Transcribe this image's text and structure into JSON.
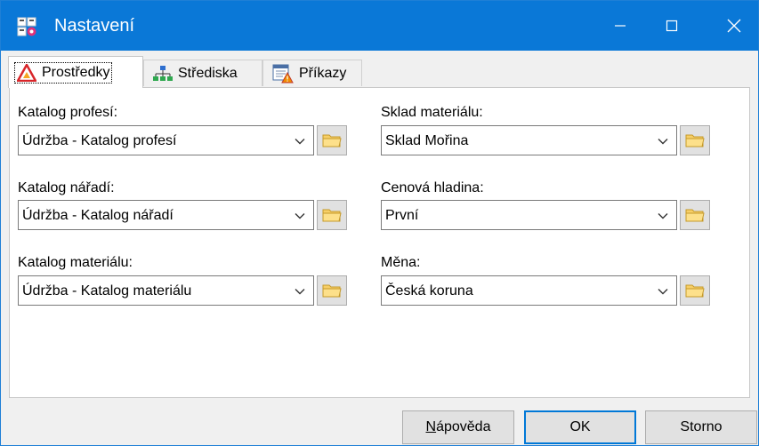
{
  "window": {
    "title": "Nastavení",
    "accent": "#0a78d7"
  },
  "tabs": [
    {
      "label": "Prostředky",
      "icon": "warning-triangle-icon",
      "active": true
    },
    {
      "label": "Střediska",
      "icon": "org-chart-icon",
      "active": false
    },
    {
      "label": "Příkazy",
      "icon": "task-list-icon",
      "active": false
    }
  ],
  "fields": {
    "katalog_profesi": {
      "label": "Katalog profesí:",
      "value": "Údržba - Katalog profesí"
    },
    "katalog_naradi": {
      "label": "Katalog nářadí:",
      "value": "Údržba - Katalog nářadí"
    },
    "katalog_materialu": {
      "label": "Katalog materiálu:",
      "value": "Údržba - Katalog materiálu"
    },
    "sklad_materialu": {
      "label": "Sklad materiálu:",
      "value": "Sklad Mořina"
    },
    "cenova_hladina": {
      "label": "Cenová hladina:",
      "value": "První"
    },
    "mena": {
      "label": "Měna:",
      "value": "Česká koruna"
    }
  },
  "buttons": {
    "help_first": "N",
    "help_rest": "ápověda",
    "ok": "OK",
    "cancel": "Storno"
  }
}
